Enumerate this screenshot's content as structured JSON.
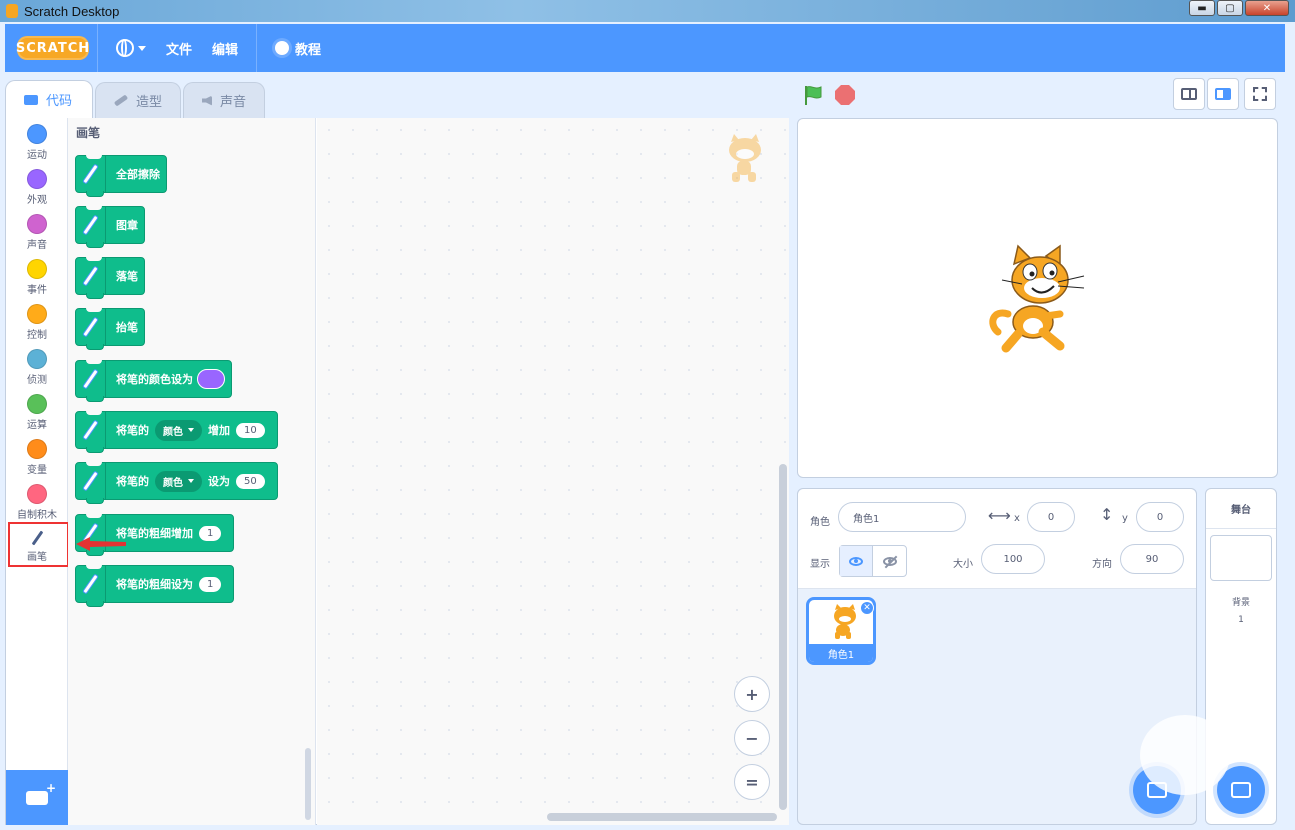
{
  "window": {
    "title": "Scratch Desktop",
    "min": "▬",
    "max": "▢",
    "close": "✕"
  },
  "menubar": {
    "logo": "SCRATCH",
    "file": "文件",
    "edit": "编辑",
    "tutorials": "教程"
  },
  "tabs": [
    {
      "label": "代码",
      "active": true
    },
    {
      "label": "造型",
      "active": false
    },
    {
      "label": "声音",
      "active": false
    }
  ],
  "categories": [
    {
      "label": "运动",
      "color": "#4c97ff"
    },
    {
      "label": "外观",
      "color": "#9966ff"
    },
    {
      "label": "声音",
      "color": "#cf63cf"
    },
    {
      "label": "事件",
      "color": "#ffd500"
    },
    {
      "label": "控制",
      "color": "#ffab19"
    },
    {
      "label": "侦测",
      "color": "#5cb1d6"
    },
    {
      "label": "运算",
      "color": "#59c059"
    },
    {
      "label": "变量",
      "color": "#ff8c1a"
    },
    {
      "label": "自制积木",
      "color": "#ff6680"
    },
    {
      "label": "画笔",
      "color": "#0fbd8c"
    }
  ],
  "flyout": {
    "title": "画笔",
    "blocks": {
      "b0": "全部擦除",
      "b1": "图章",
      "b2": "落笔",
      "b3": "抬笔",
      "b4": "将笔的颜色设为",
      "b5_pre": "将笔的",
      "b5_drop": "颜色",
      "b5_mid": "增加",
      "b5_val": "10",
      "b6_pre": "将笔的",
      "b6_drop": "颜色",
      "b6_mid": "设为",
      "b6_val": "50",
      "b7": "将笔的粗细增加",
      "b7_val": "1",
      "b8": "将笔的粗细设为",
      "b8_val": "1"
    },
    "pen_color": "#9966ff"
  },
  "zoom": {
    "in": "+",
    "out": "−",
    "reset": "="
  },
  "sprite_info": {
    "sprite_label": "角色",
    "sprite_name": "角色1",
    "x_label": "x",
    "x_value": "0",
    "y_label": "y",
    "y_value": "0",
    "show_label": "显示",
    "size_label": "大小",
    "size_value": "100",
    "direction_label": "方向",
    "direction_value": "90"
  },
  "sprites": [
    {
      "name": "角色1",
      "selected": true
    }
  ],
  "stage_panel": {
    "title": "舞台",
    "backdrop_label": "背景",
    "backdrop_count": "1"
  },
  "colors": {
    "accent": "#4c97ff",
    "pen": "#0fbd8c",
    "highlight": "#e33333"
  }
}
